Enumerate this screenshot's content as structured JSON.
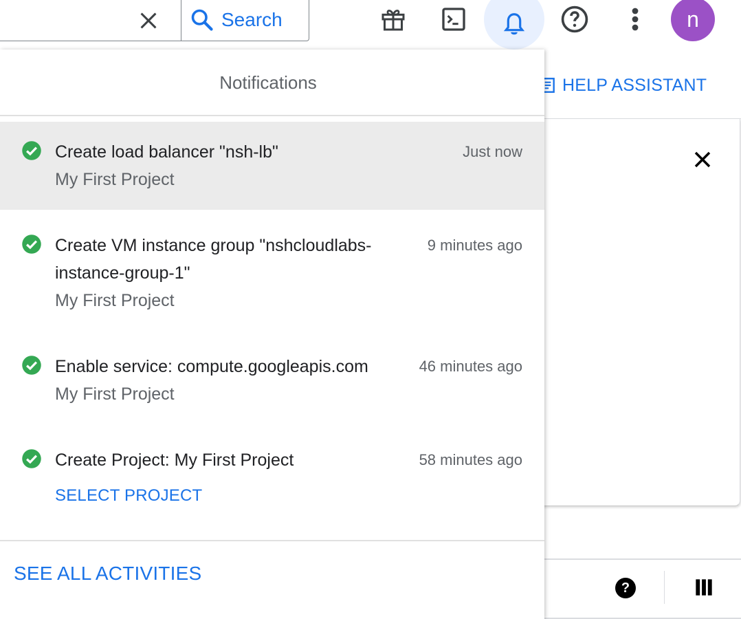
{
  "topbar": {
    "search_label": "Search",
    "icons": [
      "close-icon",
      "search-icon",
      "gift-icon",
      "terminal-icon",
      "bell-icon",
      "help-icon",
      "more-vert-icon"
    ],
    "avatar_initial": "n",
    "avatar_color": "#9b51c6",
    "accent_color": "#1a73e8"
  },
  "background": {
    "help_assistant_label": "HELP ASSISTANT"
  },
  "notifications": {
    "title": "Notifications",
    "items": [
      {
        "name": "Create load balancer \"nsh-lb\"",
        "time": "Just now",
        "project": "My First Project",
        "status": "success"
      },
      {
        "name": "Create VM instance group \"nshcloudlabs-instance-group-1\"",
        "time": "9 minutes ago",
        "project": "My First Project",
        "status": "success"
      },
      {
        "name": "Enable service: compute.googleapis.com",
        "time": "46 minutes ago",
        "project": "My First Project",
        "status": "success"
      },
      {
        "name": "Create Project: My First Project",
        "time": "58 minutes ago",
        "action": "SELECT PROJECT",
        "status": "success"
      }
    ],
    "see_all_label": "SEE ALL ACTIVITIES",
    "success_color": "#34a853"
  }
}
